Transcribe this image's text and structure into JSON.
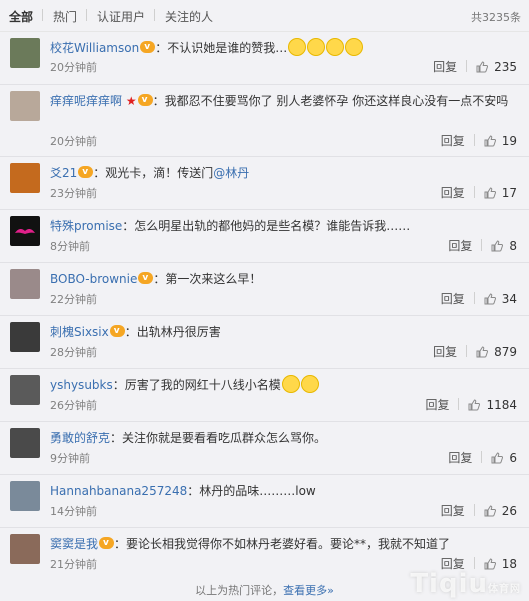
{
  "tabs": [
    "全部",
    "热门",
    "认证用户",
    "关注的人"
  ],
  "total": "共3235条",
  "actions": {
    "reply": "回复"
  },
  "comments": [
    {
      "user": "校花Williamson",
      "text": "：不认识她是谁的赞我…",
      "time": "20分钟前",
      "likes": "235",
      "avatar_color": "#6b7a5a"
    },
    {
      "user": "痒痒呢痒痒啊",
      "text": "：我都忍不住要骂你了 别人老婆怀孕 你还这样良心没有一点不安吗",
      "time": "20分钟前",
      "likes": "19",
      "avatar_color": "#b8a89a"
    },
    {
      "user": "爻21",
      "text": "：观光卡，滴！传送门",
      "mention": "@林丹",
      "time": "23分钟前",
      "likes": "17",
      "avatar_color": "#c46a1e"
    },
    {
      "user": "特殊promise",
      "text": "：怎么明星出轨的都他妈的是些名模？谁能告诉我……",
      "time": "8分钟前",
      "likes": "8",
      "avatar_color": "#111111"
    },
    {
      "user": "BOBO-brownie",
      "text": "：第一次来这么早！",
      "time": "22分钟前",
      "likes": "34",
      "avatar_color": "#9a8a8a"
    },
    {
      "user": "刺槐Sixsix",
      "text": "：出轨林丹很厉害",
      "time": "28分钟前",
      "likes": "879",
      "avatar_color": "#3a3a3a"
    },
    {
      "user": "yshysubks",
      "text": "：厉害了我的网红十八线小名模",
      "time": "26分钟前",
      "likes": "1184",
      "avatar_color": "#5a5a5a"
    },
    {
      "user": "勇敢的舒克",
      "text": "：关注你就是要看看吃瓜群众怎么骂你。",
      "time": "9分钟前",
      "likes": "6",
      "avatar_color": "#4a4a4a"
    },
    {
      "user": "Hannahbanana257248",
      "text": "：林丹的品味………low",
      "time": "14分钟前",
      "likes": "26",
      "avatar_color": "#7a8a9a"
    },
    {
      "user": "窦窦是我",
      "text": "：要论长相我觉得你不如林丹老婆好看。要论**，我就不知道了",
      "time": "21分钟前",
      "likes": "18",
      "avatar_color": "#8a6a5a"
    }
  ],
  "footer": {
    "text": "以上为热门评论，",
    "more": "查看更多»"
  },
  "watermark": {
    "main": "Tiqiu",
    "sub": "体育网"
  }
}
